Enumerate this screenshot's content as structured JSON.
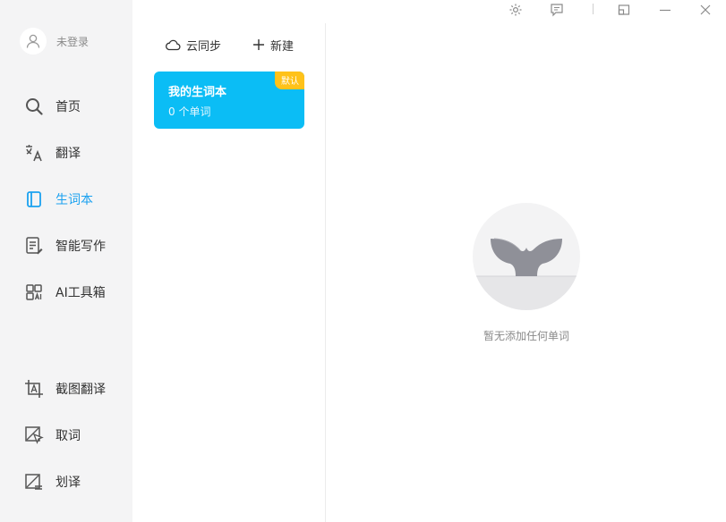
{
  "user": {
    "label": "未登录"
  },
  "nav": {
    "home": "首页",
    "translate": "翻译",
    "wordbook": "生词本",
    "writing": "智能写作",
    "ai_tools": "AI工具箱",
    "screenshot_translate": "截图翻译",
    "word_pick": "取词",
    "select_translate": "划译"
  },
  "toolbar": {
    "cloud_sync": "云同步",
    "new": "新建"
  },
  "wordbooks": [
    {
      "title": "我的生词本",
      "count": "0 个单词",
      "badge": "默认"
    }
  ],
  "empty_state": {
    "message": "暂无添加任何单词"
  },
  "colors": {
    "accent": "#1aa1f0",
    "card": "#0bbdf5",
    "badge": "#ffc21a",
    "sidebar": "#f4f4f5"
  }
}
